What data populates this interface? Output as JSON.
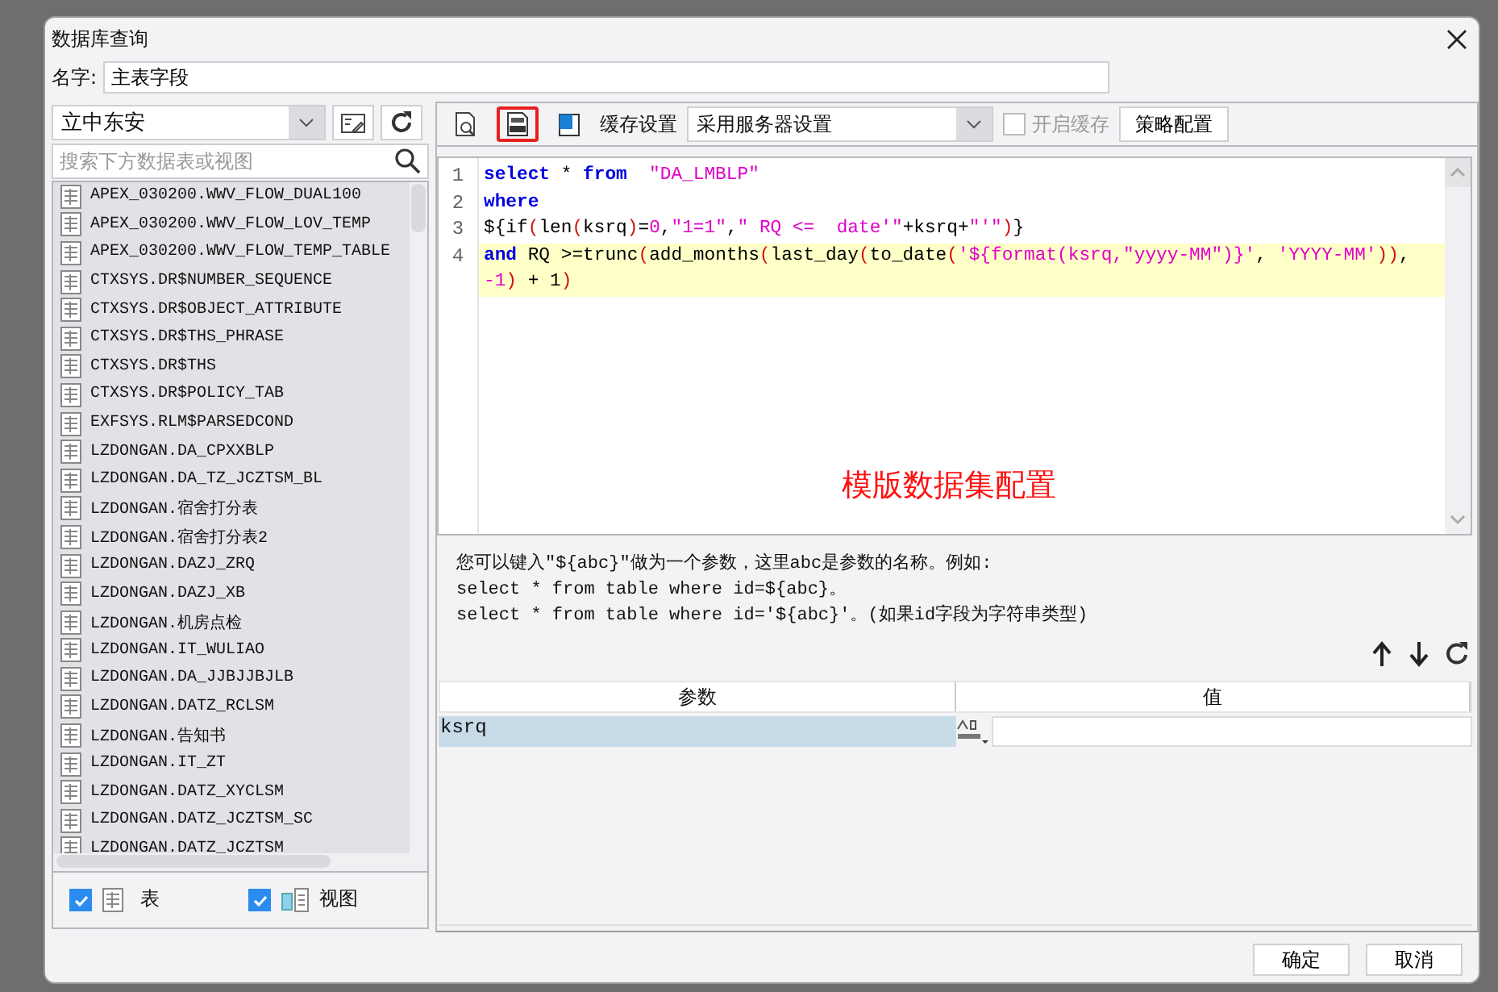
{
  "dialog": {
    "title": "数据库查询"
  },
  "name_field": {
    "label": "名字:",
    "value": "主表字段"
  },
  "left_panel": {
    "connection": "立中东安",
    "search": {
      "placeholder": "搜索下方数据表或视图"
    },
    "tables": [
      "APEX_030200.WWV_FLOW_DUAL100",
      "APEX_030200.WWV_FLOW_LOV_TEMP",
      "APEX_030200.WWV_FLOW_TEMP_TABLE",
      "CTXSYS.DR$NUMBER_SEQUENCE",
      "CTXSYS.DR$OBJECT_ATTRIBUTE",
      "CTXSYS.DR$THS_PHRASE",
      "CTXSYS.DR$THS",
      "CTXSYS.DR$POLICY_TAB",
      "EXFSYS.RLM$PARSEDCOND",
      "LZDONGAN.DA_CPXXBLP",
      "LZDONGAN.DA_TZ_JCZTSM_BL",
      "LZDONGAN.宿舍打分表",
      "LZDONGAN.宿舍打分表2",
      "LZDONGAN.DAZJ_ZRQ",
      "LZDONGAN.DAZJ_XB",
      "LZDONGAN.机房点检",
      "LZDONGAN.IT_WULIAO",
      "LZDONGAN.DA_JJBJJBJLB",
      "LZDONGAN.DATZ_RCLSM",
      "LZDONGAN.告知书",
      "LZDONGAN.IT_ZT",
      "LZDONGAN.DATZ_XYCLSM",
      "LZDONGAN.DATZ_JCZTSM_SC",
      "LZDONGAN.DATZ_JCZTSM"
    ],
    "filters": [
      {
        "kind": "table",
        "label": "表",
        "checked": true
      },
      {
        "kind": "view",
        "label": "视图",
        "checked": true
      }
    ]
  },
  "toolbar": {
    "tools": [
      {
        "kind": "preview",
        "highlighted": false
      },
      {
        "kind": "sql",
        "highlighted": true
      },
      {
        "kind": "template",
        "highlighted": false
      }
    ],
    "cache_label": "缓存设置",
    "cache_mode": "采用服务器设置",
    "enable_cache": {
      "label": "开启缓存",
      "checked": false,
      "disabled": true
    },
    "policy_button": "策略配置"
  },
  "editor": {
    "lines": [
      {
        "number": "1",
        "current": false,
        "tokens": [
          {
            "text": "select",
            "kind": "keyword"
          },
          {
            "text": " * ",
            "kind": "plain"
          },
          {
            "text": "from",
            "kind": "keyword"
          },
          {
            "text": "  \"DA_LMBLP\"",
            "kind": "string"
          }
        ]
      },
      {
        "number": "2",
        "current": false,
        "tokens": [
          {
            "text": "where",
            "kind": "keyword"
          }
        ]
      },
      {
        "number": "3",
        "current": false,
        "tokens": [
          {
            "text": "${if",
            "kind": "plain"
          },
          {
            "text": "(",
            "kind": "paren"
          },
          {
            "text": "len",
            "kind": "plain"
          },
          {
            "text": "(",
            "kind": "paren"
          },
          {
            "text": "ksrq",
            "kind": "plain"
          },
          {
            "text": ")",
            "kind": "paren"
          },
          {
            "text": "=",
            "kind": "plain"
          },
          {
            "text": "0",
            "kind": "string"
          },
          {
            "text": ",",
            "kind": "plain"
          },
          {
            "text": "\"1=1\"",
            "kind": "string"
          },
          {
            "text": ",",
            "kind": "plain"
          },
          {
            "text": "\" RQ <=  date'\"",
            "kind": "string"
          },
          {
            "text": "+ksrq+",
            "kind": "plain"
          },
          {
            "text": "\"'\"",
            "kind": "string"
          },
          {
            "text": ")",
            "kind": "paren"
          },
          {
            "text": "}",
            "kind": "plain"
          }
        ]
      },
      {
        "number": "4",
        "current": true,
        "tokens": [
          {
            "text": "and",
            "kind": "keyword"
          },
          {
            "text": " RQ >=trunc",
            "kind": "plain"
          },
          {
            "text": "(",
            "kind": "paren"
          },
          {
            "text": "add_months",
            "kind": "plain"
          },
          {
            "text": "(",
            "kind": "paren"
          },
          {
            "text": "last_day",
            "kind": "plain"
          },
          {
            "text": "(",
            "kind": "paren"
          },
          {
            "text": "to_date",
            "kind": "plain"
          },
          {
            "text": "(",
            "kind": "paren"
          },
          {
            "text": "'${format(ksrq,\"yyyy-MM\")}'",
            "kind": "string"
          },
          {
            "text": ", ",
            "kind": "plain"
          },
          {
            "text": "'YYYY-MM'",
            "kind": "string"
          },
          {
            "text": "))",
            "kind": "paren"
          },
          {
            "text": ",",
            "kind": "plain"
          }
        ],
        "wrapped_tokens": [
          {
            "text": "-1",
            "kind": "string"
          },
          {
            "text": ")",
            "kind": "paren"
          },
          {
            "text": " + 1",
            "kind": "plain"
          },
          {
            "text": ")",
            "kind": "paren"
          }
        ]
      }
    ],
    "annotation": "模版数据集配置"
  },
  "help": [
    "您可以键入\"${abc}\"做为一个参数，这里abc是参数的名称。例如:",
    "select * from table where id=${abc}。",
    "select * from table where id='${abc}'。(如果id字段为字符串类型)"
  ],
  "params": {
    "columns": [
      "参数",
      "值"
    ],
    "rows": [
      {
        "name": "ksrq",
        "selected": true
      }
    ]
  },
  "buttons": [
    "确定",
    "取消"
  ]
}
